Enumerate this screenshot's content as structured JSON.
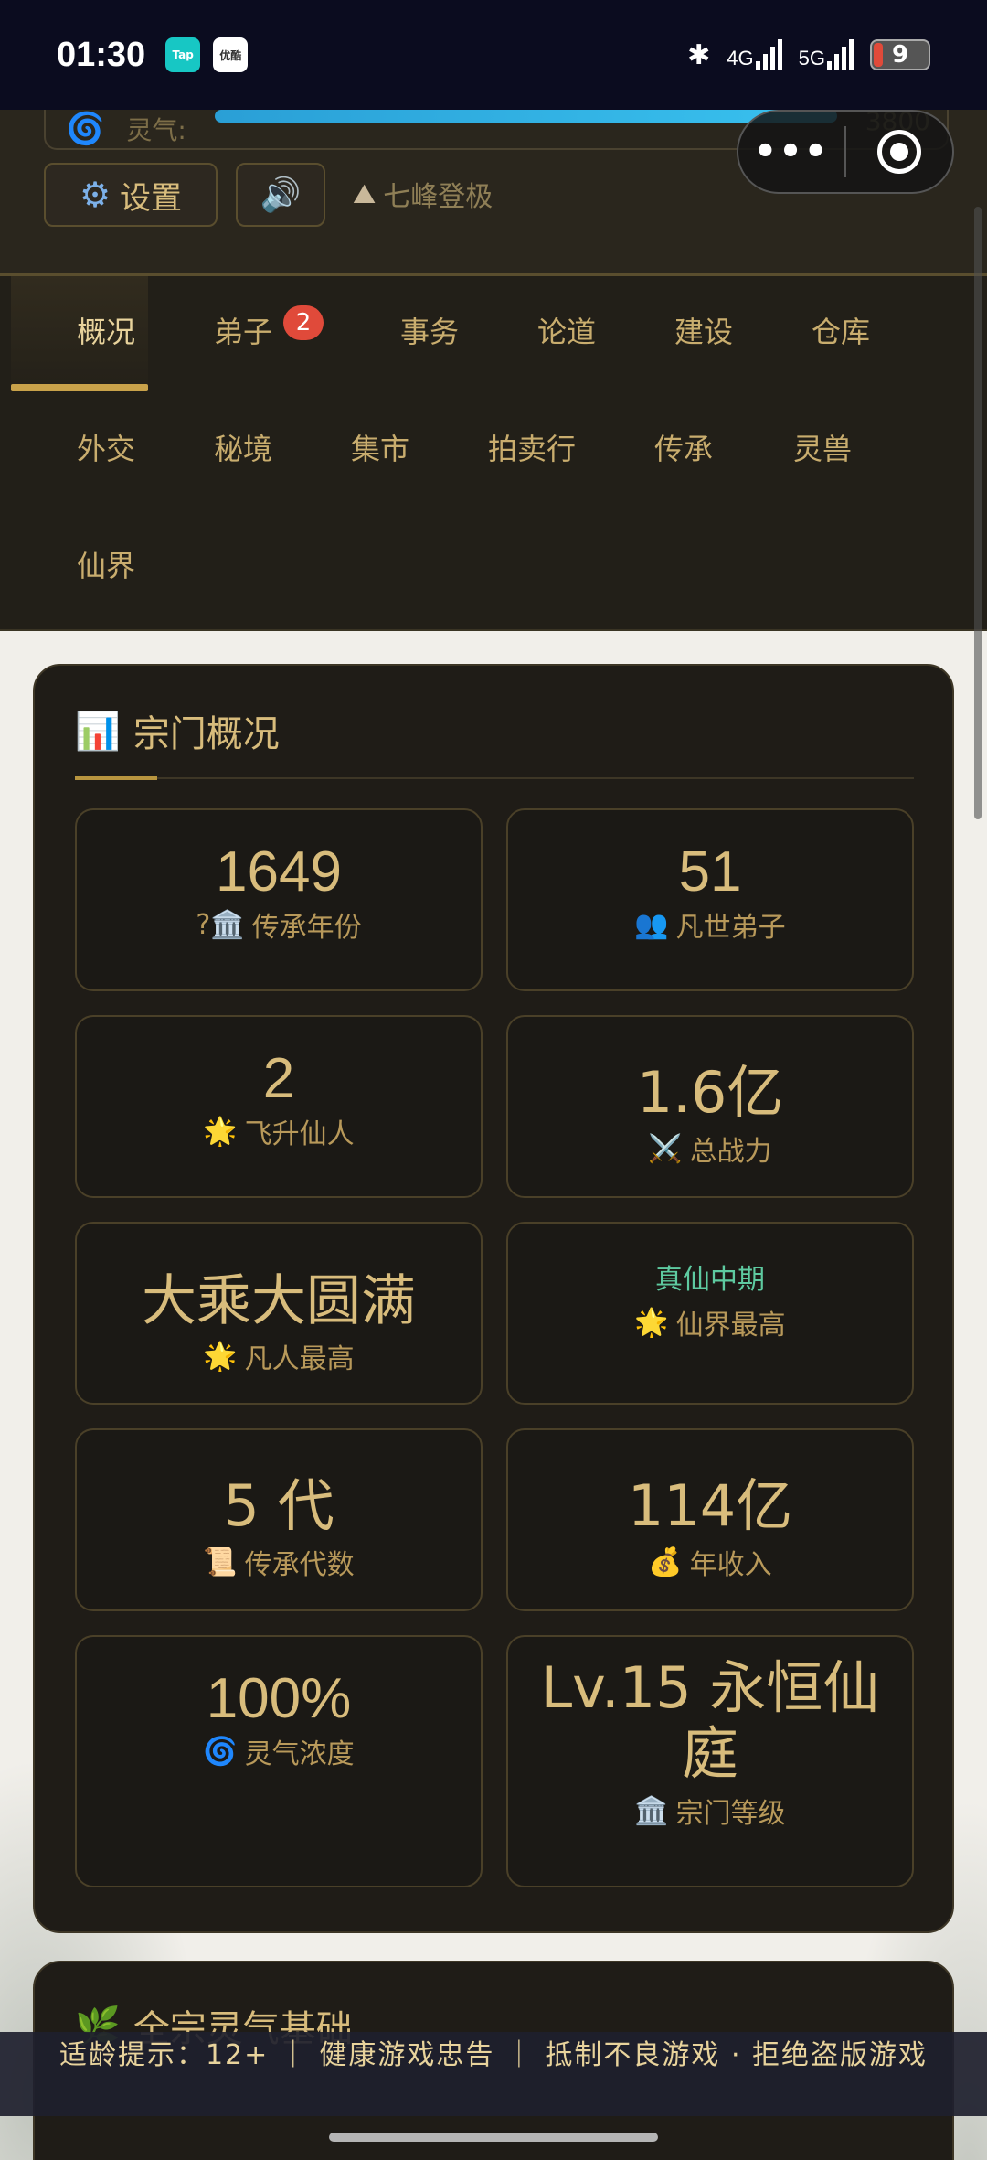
{
  "status_bar": {
    "time": "01:30",
    "apps": [
      "Tap",
      "优酷"
    ],
    "net1": "4G",
    "net2": "5G",
    "battery": "9"
  },
  "header": {
    "aura_label": "灵气:",
    "aura_value": "3800",
    "aura_fill_fraction": 0.83,
    "settings_label": "设置",
    "realm": "七峰登极",
    "capsule_dots": "•••"
  },
  "tabs": {
    "row1": [
      "概况",
      "弟子",
      "事务",
      "论道",
      "建设",
      "仓库"
    ],
    "row2": [
      "外交",
      "秘境",
      "集市",
      "拍卖行",
      "传承",
      "灵兽"
    ],
    "row3": [
      "仙界"
    ],
    "disciple_badge": "2",
    "active": "概况"
  },
  "overview": {
    "title": "宗门概况",
    "stats": [
      {
        "value": "1649",
        "icon": "?🏛️",
        "label": "传承年份"
      },
      {
        "value": "51",
        "icon": "👥",
        "label": "凡世弟子"
      },
      {
        "value": "2",
        "icon": "🌟",
        "label": "飞升仙人"
      },
      {
        "value": "1.6亿",
        "icon": "⚔️",
        "label": "总战力"
      },
      {
        "value": "大乘大圆满",
        "icon": "🌟",
        "label": "凡人最高"
      },
      {
        "value": "真仙中期",
        "icon": "🌟",
        "label": "仙界最高"
      },
      {
        "value": "5 代",
        "icon": "📜",
        "label": "传承代数"
      },
      {
        "value": "114亿",
        "icon": "💰",
        "label": "年收入"
      },
      {
        "value": "100%",
        "icon": "🌀",
        "label": "灵气浓度"
      },
      {
        "value": "Lv.15 永恒仙庭",
        "icon": "🏛️",
        "label": "宗门等级"
      }
    ]
  },
  "second_card": {
    "title": "全宗灵气基础"
  },
  "notice": {
    "line": "适龄提示：12+   ｜   健康游戏忠告   ｜   抵制不良游戏 · 拒绝盗版游戏"
  }
}
